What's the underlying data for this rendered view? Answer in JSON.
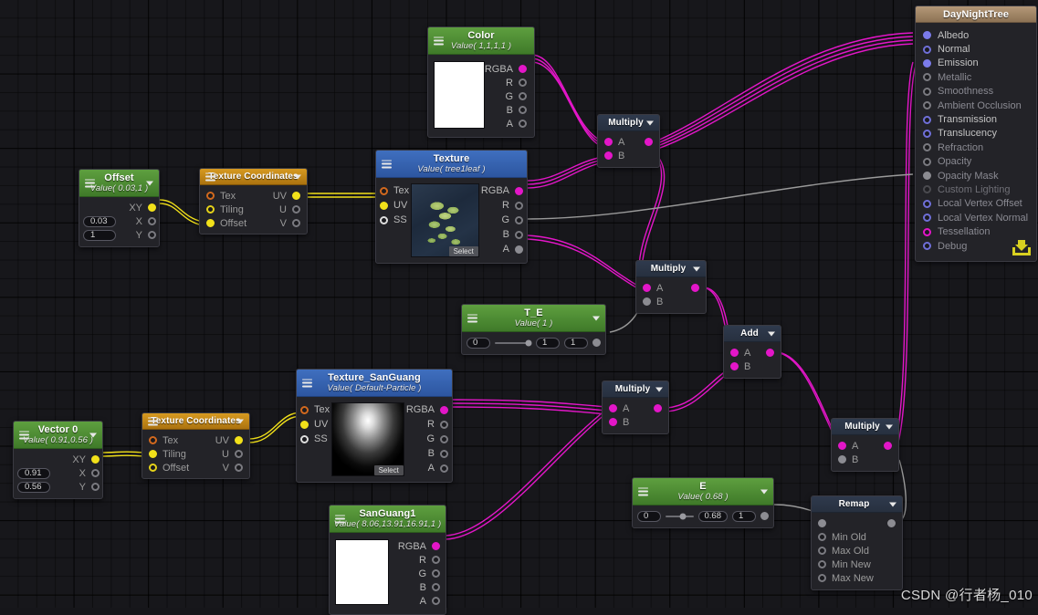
{
  "watermark": "CSDN @行者杨_010",
  "colors": {
    "background": "#17171b",
    "wire_magenta": "#e316c8",
    "wire_yellow": "#f2e11a",
    "wire_gray": "#9a9a9a",
    "header_green": "#4f8c33",
    "header_orange": "#c08a1c",
    "header_blue": "#36619f",
    "header_tan": "#a38a68"
  },
  "master": {
    "title": "DayNightTree",
    "ports": [
      {
        "label": "Albedo",
        "state": "filled-blue"
      },
      {
        "label": "Normal",
        "state": "open-blue"
      },
      {
        "label": "Emission",
        "state": "filled-blue"
      },
      {
        "label": "Metallic",
        "state": "open-gray"
      },
      {
        "label": "Smoothness",
        "state": "open-gray"
      },
      {
        "label": "Ambient Occlusion",
        "state": "open-gray"
      },
      {
        "label": "Transmission",
        "state": "open-blue"
      },
      {
        "label": "Translucency",
        "state": "open-blue"
      },
      {
        "label": "Refraction",
        "state": "open-gray"
      },
      {
        "label": "Opacity",
        "state": "open-gray"
      },
      {
        "label": "Opacity Mask",
        "state": "filled-gray"
      },
      {
        "label": "Custom Lighting",
        "state": "disabled"
      },
      {
        "label": "Local Vertex Offset",
        "state": "open-blue"
      },
      {
        "label": "Local Vertex Normal",
        "state": "open-blue"
      },
      {
        "label": "Tessellation",
        "state": "open-magenta"
      },
      {
        "label": "Debug",
        "state": "open-blue"
      }
    ],
    "download_icon": "download-icon"
  },
  "nodes": {
    "color": {
      "title": "Color",
      "subtitle": "Value( 1,1,1,1 )",
      "outputs": [
        "RGBA",
        "R",
        "G",
        "B",
        "A"
      ]
    },
    "texture": {
      "title": "Texture",
      "subtitle": "Value( tree1leaf )",
      "inputs": [
        "Tex",
        "UV",
        "SS"
      ],
      "outputs": [
        "RGBA",
        "R",
        "G",
        "B",
        "A"
      ],
      "select_label": "Select"
    },
    "texture_coordinates_top": {
      "title": "Texture Coordinates",
      "inputs": [
        "Tex",
        "Tiling",
        "Offset"
      ],
      "outputs": [
        "UV",
        "U",
        "V"
      ]
    },
    "offset": {
      "title": "Offset",
      "subtitle": "Value( 0.03,1 )",
      "outputs": [
        "XY",
        "X",
        "Y"
      ],
      "fields": [
        "0.03",
        "1"
      ]
    },
    "vector0": {
      "title": "Vector 0",
      "subtitle": "Value( 0.91,0.56 )",
      "outputs": [
        "XY",
        "X",
        "Y"
      ],
      "fields": [
        "0.91",
        "0.56"
      ]
    },
    "texture_coordinates_bottom": {
      "title": "Texture Coordinates",
      "inputs": [
        "Tex",
        "Tiling",
        "Offset"
      ],
      "outputs": [
        "UV",
        "U",
        "V"
      ]
    },
    "texture_sanguang": {
      "title": "Texture_SanGuang",
      "subtitle": "Value( Default-Particle )",
      "inputs": [
        "Tex",
        "UV",
        "SS"
      ],
      "outputs": [
        "RGBA",
        "R",
        "G",
        "B",
        "A"
      ],
      "select_label": "Select"
    },
    "sanguang1": {
      "title": "SanGuang1",
      "subtitle": "Value( 8.06,13.91,16.91,1 )",
      "outputs": [
        "RGBA",
        "R",
        "G",
        "B",
        "A"
      ]
    },
    "t_e": {
      "title": "T_E",
      "subtitle": "Value( 1 )",
      "slider_min": "0",
      "slider_value": "1",
      "slider_max": "1",
      "slider_pct": 92
    },
    "e": {
      "title": "E",
      "subtitle": "Value( 0.68 )",
      "slider_min": "0",
      "slider_value": "0.68",
      "slider_max": "1",
      "slider_pct": 62
    },
    "multiply1": {
      "title": "Multiply",
      "inputs": [
        "A",
        "B"
      ]
    },
    "multiply2": {
      "title": "Multiply",
      "inputs": [
        "A",
        "B"
      ]
    },
    "multiply3": {
      "title": "Multiply",
      "inputs": [
        "A",
        "B"
      ]
    },
    "multiply4": {
      "title": "Multiply",
      "inputs": [
        "A",
        "B"
      ]
    },
    "add": {
      "title": "Add",
      "inputs": [
        "A",
        "B"
      ]
    },
    "remap": {
      "title": "Remap",
      "inputs": [
        "Min Old",
        "Max Old",
        "Min New",
        "Max New"
      ]
    }
  }
}
